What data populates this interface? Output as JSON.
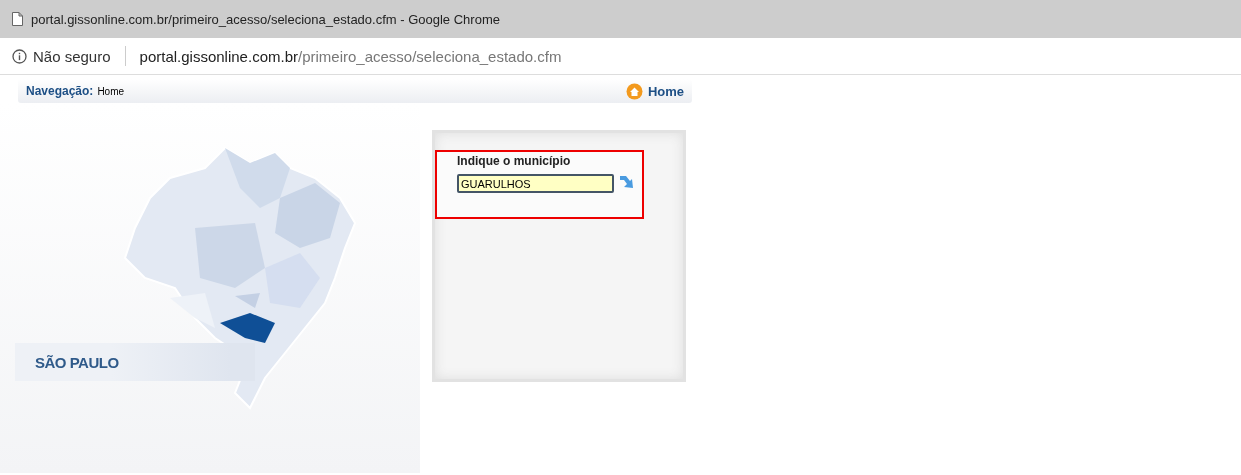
{
  "window": {
    "title": "portal.gissonline.com.br/primeiro_acesso/seleciona_estado.cfm - Google Chrome"
  },
  "address_bar": {
    "security": "Não seguro",
    "host": "portal.gissonline.com.br",
    "path": "/primeiro_acesso/seleciona_estado.cfm"
  },
  "navigation": {
    "label": "Navegação:",
    "current": "Home",
    "home_link": "Home"
  },
  "map": {
    "state_label": "SÃO PAULO"
  },
  "municipality_panel": {
    "label": "Indique o município",
    "value": "GUARULHOS",
    "highlighted": true
  }
}
